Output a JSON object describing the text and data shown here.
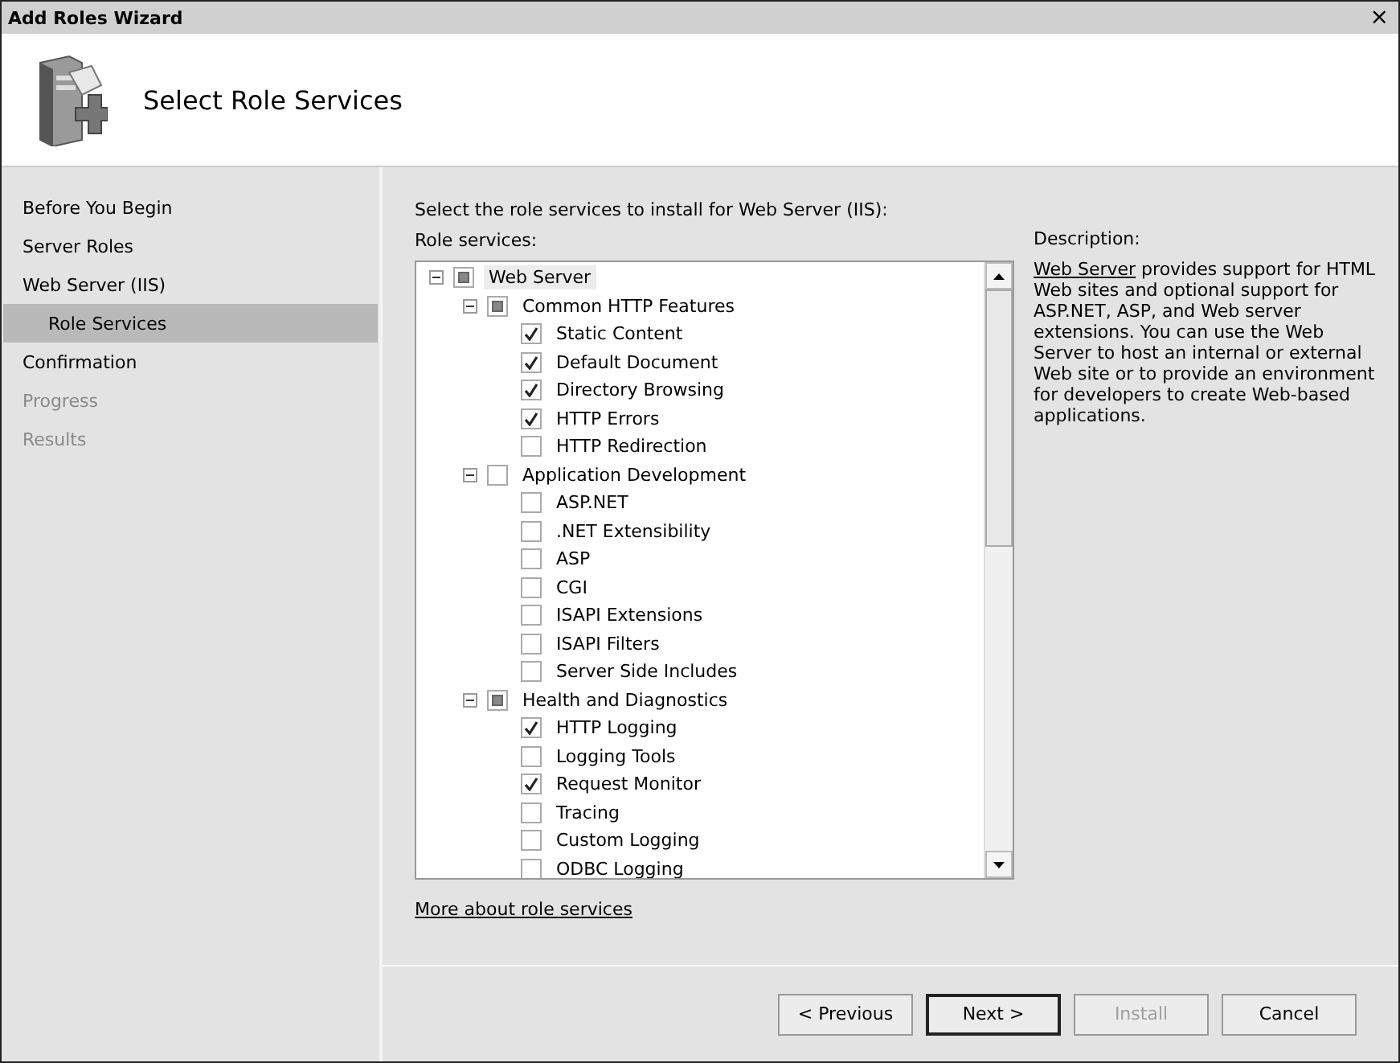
{
  "window": {
    "title": "Add Roles Wizard",
    "close": "×"
  },
  "header": {
    "title": "Select Role Services"
  },
  "steps": [
    {
      "label": "Before You Begin",
      "selected": false,
      "disabled": false
    },
    {
      "label": "Server Roles",
      "selected": false,
      "disabled": false
    },
    {
      "label": "Web Server (IIS)",
      "selected": false,
      "disabled": false,
      "children": [
        {
          "label": "Role Services",
          "selected": true,
          "disabled": false
        }
      ]
    },
    {
      "label": "Confirmation",
      "selected": false,
      "disabled": false
    },
    {
      "label": "Progress",
      "selected": false,
      "disabled": true
    },
    {
      "label": "Results",
      "selected": false,
      "disabled": true
    }
  ],
  "instruction": "Select the role services to install for Web Server (IIS):",
  "services_label": "Role services:",
  "services": [
    {
      "label": "Web Server",
      "checked": false,
      "partial": true,
      "expanded": true,
      "selected": true,
      "children": [
        {
          "label": "Common HTTP Features",
          "checked": false,
          "partial": true,
          "expanded": true,
          "selected": false,
          "children": [
            {
              "label": "Static Content",
              "checked": true,
              "selected": false
            },
            {
              "label": "Default Document",
              "checked": true,
              "selected": false
            },
            {
              "label": "Directory Browsing",
              "checked": true,
              "selected": false
            },
            {
              "label": "HTTP Errors",
              "checked": true,
              "selected": false
            },
            {
              "label": "HTTP Redirection",
              "checked": false,
              "selected": false
            }
          ]
        },
        {
          "label": "Application Development",
          "checked": false,
          "partial": false,
          "expanded": true,
          "selected": false,
          "children": [
            {
              "label": "ASP.NET",
              "checked": false,
              "selected": false
            },
            {
              "label": ".NET Extensibility",
              "checked": false,
              "selected": false
            },
            {
              "label": "ASP",
              "checked": false,
              "selected": false
            },
            {
              "label": "CGI",
              "checked": false,
              "selected": false
            },
            {
              "label": "ISAPI Extensions",
              "checked": false,
              "selected": false
            },
            {
              "label": "ISAPI Filters",
              "checked": false,
              "selected": false
            },
            {
              "label": "Server Side Includes",
              "checked": false,
              "selected": false
            }
          ]
        },
        {
          "label": "Health and Diagnostics",
          "checked": false,
          "partial": true,
          "expanded": true,
          "selected": false,
          "children": [
            {
              "label": "HTTP Logging",
              "checked": true,
              "selected": false
            },
            {
              "label": "Logging Tools",
              "checked": false,
              "selected": false
            },
            {
              "label": "Request Monitor",
              "checked": true,
              "selected": false
            },
            {
              "label": "Tracing",
              "checked": false,
              "selected": false
            },
            {
              "label": "Custom Logging",
              "checked": false,
              "selected": false
            },
            {
              "label": "ODBC Logging",
              "checked": false,
              "selected": false
            }
          ]
        }
      ]
    }
  ],
  "description": {
    "heading": "Description:",
    "link": "Web Server",
    "text": " provides support for HTML Web sites and optional support for ASP.NET, ASP, and Web server extensions. You can use the Web Server to host an internal or external Web site or to provide an environment for developers to create Web-based applications."
  },
  "more_link": "More about role services",
  "buttons": [
    {
      "label": "< Previous",
      "default": false,
      "disabled": false
    },
    {
      "label": "Next >",
      "default": true,
      "disabled": false
    },
    {
      "label": "Install",
      "default": false,
      "disabled": true
    },
    {
      "label": "Cancel",
      "default": false,
      "disabled": false
    }
  ]
}
